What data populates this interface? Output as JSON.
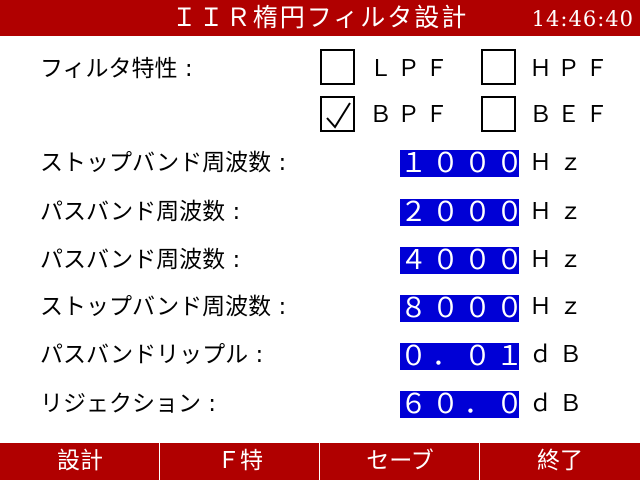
{
  "header": {
    "title": "ＩＩＲ楕円フィルタ設計",
    "clock": "14:46:40"
  },
  "filter_type": {
    "label": "フィルタ特性 :",
    "options": [
      {
        "label": "ＬＰＦ",
        "checked": false
      },
      {
        "label": "ＨＰＦ",
        "checked": false
      },
      {
        "label": "ＢＰＦ",
        "checked": true
      },
      {
        "label": "ＢＥＦ",
        "checked": false
      }
    ]
  },
  "params": [
    {
      "label": "ストップバンド周波数 :",
      "value": "１０００",
      "unit": "Ｈｚ"
    },
    {
      "label": "パスバンド周波数 :",
      "value": "２０００",
      "unit": "Ｈｚ"
    },
    {
      "label": "パスバンド周波数 :",
      "value": "４０００",
      "unit": "Ｈｚ"
    },
    {
      "label": "ストップバンド周波数 :",
      "value": "８０００",
      "unit": "Ｈｚ"
    },
    {
      "label": "パスバンドリップル :",
      "value": "０．０１",
      "unit": "ｄＢ"
    },
    {
      "label": "リジェクション :",
      "value": "６０．００",
      "unit": "ｄＢ"
    }
  ],
  "footer": {
    "buttons": [
      "設計",
      "Ｆ特",
      "セーブ",
      "終了"
    ]
  },
  "colors": {
    "bar": "#b00000",
    "field": "#0000d6"
  }
}
